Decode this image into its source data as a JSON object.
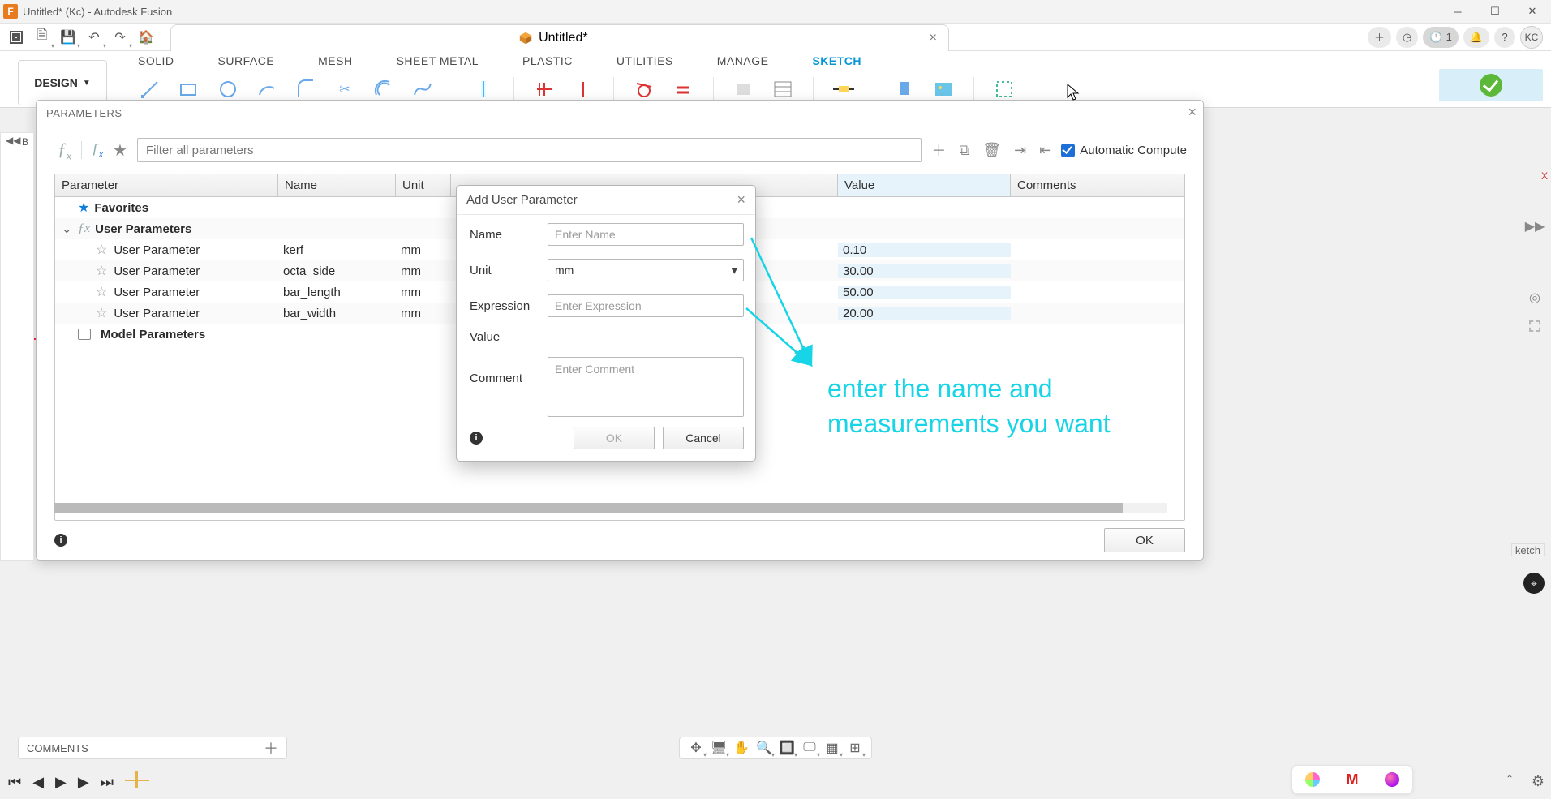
{
  "window": {
    "title": "Untitled* (Kc) - Autodesk Fusion"
  },
  "tab": {
    "title": "Untitled*"
  },
  "header": {
    "user_initials": "KC",
    "job_count": "1"
  },
  "workspace": {
    "label": "DESIGN"
  },
  "ribbon": {
    "tabs": [
      "SOLID",
      "SURFACE",
      "MESH",
      "SHEET METAL",
      "PLASTIC",
      "UTILITIES",
      "MANAGE",
      "SKETCH"
    ],
    "active": "SKETCH"
  },
  "parameters_panel": {
    "title": "PARAMETERS",
    "filter_placeholder": "Filter all parameters",
    "auto_compute_label": "Automatic Compute",
    "columns": {
      "parameter": "Parameter",
      "name": "Name",
      "unit": "Unit",
      "value": "Value",
      "comments": "Comments"
    },
    "favorites_label": "Favorites",
    "user_params_label": "User Parameters",
    "model_params_label": "Model Parameters",
    "row_label": "User Parameter",
    "rows": [
      {
        "name": "kerf",
        "unit": "mm",
        "value": "0.10"
      },
      {
        "name": "octa_side",
        "unit": "mm",
        "value": "30.00"
      },
      {
        "name": "bar_length",
        "unit": "mm",
        "value": "50.00"
      },
      {
        "name": "bar_width",
        "unit": "mm",
        "value": "20.00"
      }
    ],
    "ok_label": "OK"
  },
  "add_param": {
    "title": "Add User Parameter",
    "labels": {
      "name": "Name",
      "unit": "Unit",
      "expression": "Expression",
      "value": "Value",
      "comment": "Comment"
    },
    "placeholders": {
      "name": "Enter Name",
      "expression": "Enter Expression",
      "comment": "Enter Comment"
    },
    "unit_value": "mm",
    "ok": "OK",
    "cancel": "Cancel"
  },
  "annotation": {
    "line1": "enter the name and",
    "line2": "measurements you want"
  },
  "comments": {
    "label": "COMMENTS"
  },
  "misc": {
    "ketch": "ketch",
    "x_label": "X"
  }
}
